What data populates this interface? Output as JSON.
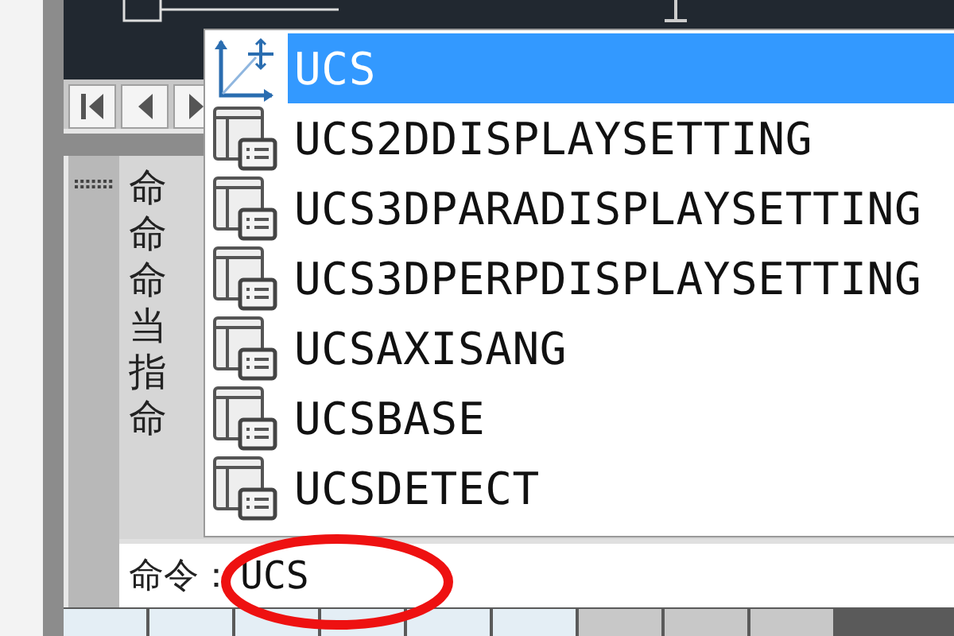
{
  "navigation": {
    "buttons": [
      {
        "kind": "first"
      },
      {
        "kind": "previous"
      },
      {
        "kind": "next"
      }
    ]
  },
  "command_history": {
    "lines": [
      "命",
      "命",
      "命",
      "当",
      "指",
      "命"
    ]
  },
  "command_line": {
    "label": "命令：",
    "value": "UCS"
  },
  "autocomplete": {
    "items": [
      {
        "label": "UCS",
        "kind": "command",
        "selected": true
      },
      {
        "label": "UCS2DDISPLAYSETTING",
        "kind": "variable",
        "selected": false
      },
      {
        "label": "UCS3DPARADISPLAYSETTING",
        "kind": "variable",
        "selected": false
      },
      {
        "label": "UCS3DPERPDISPLAYSETTING",
        "kind": "variable",
        "selected": false
      },
      {
        "label": "UCSAXISANG",
        "kind": "variable",
        "selected": false
      },
      {
        "label": "UCSBASE",
        "kind": "variable",
        "selected": false
      },
      {
        "label": "UCSDETECT",
        "kind": "variable",
        "selected": false
      }
    ]
  }
}
